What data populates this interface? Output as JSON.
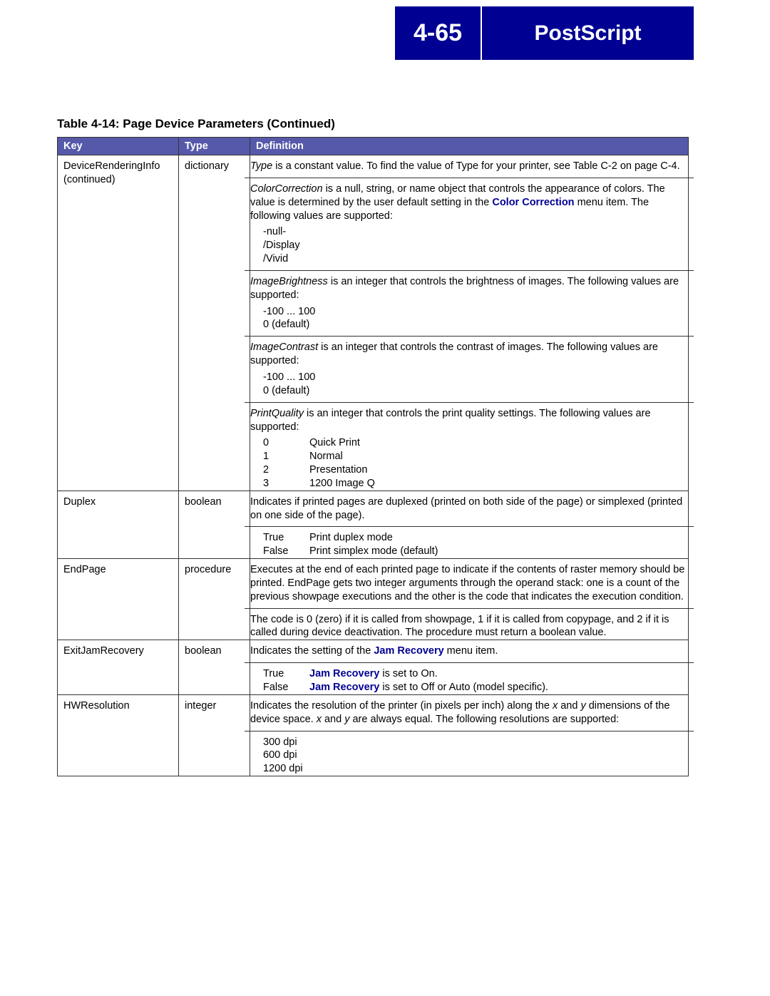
{
  "header": {
    "page_number": "4-65",
    "chapter_title": "PostScript"
  },
  "table": {
    "caption": "Table 4-14:  Page Device Parameters (Continued)",
    "headers": {
      "key": "Key",
      "type": "Type",
      "def": "Definition"
    },
    "rows": [
      {
        "key": "DeviceRenderingInfo (continued)",
        "type": "dictionary",
        "def": {
          "type_para_pre": "Type",
          "type_para": " is a constant value. To find the value of Type for your printer, see Table C-2 on page C-4.",
          "cc_pre": "ColorCorrection",
          "cc_mid": " is a null, string, or name object that controls the appearance of colors. The value is determined by the user default setting in the ",
          "cc_link": "Color Correction",
          "cc_post": " menu item. The following values are supported:",
          "cc_vals": [
            "-null-",
            "/Display",
            "/Vivid"
          ],
          "ib_pre": "ImageBrightness",
          "ib_text": " is an integer that controls the brightness of images. The following values are supported:",
          "ib_vals": [
            "-100 ... 100",
            "0 (default)"
          ],
          "ic_pre": "ImageContrast",
          "ic_text": " is an integer that controls the contrast of images. The following values are supported:",
          "ic_vals": [
            "-100 ... 100",
            "0 (default)"
          ],
          "pq_pre": "PrintQuality",
          "pq_text": " is an integer that controls the print quality settings. The following values are supported:",
          "pq_vals": [
            {
              "n": "0",
              "d": "Quick Print"
            },
            {
              "n": "1",
              "d": "Normal"
            },
            {
              "n": "2",
              "d": "Presentation"
            },
            {
              "n": "3",
              "d": "1200 Image Q"
            }
          ]
        }
      },
      {
        "key": "Duplex",
        "type": "boolean",
        "def": {
          "intro": "Indicates if printed pages are duplexed (printed on both side of the page) or simplexed (printed on one side of the page).",
          "vals": [
            {
              "n": "True",
              "d": "Print duplex mode"
            },
            {
              "n": "False",
              "d": "Print simplex mode (default)"
            }
          ]
        }
      },
      {
        "key": "EndPage",
        "type": "procedure",
        "def": {
          "p1": "Executes at the end of each printed page to indicate if the contents of raster memory should be printed. EndPage gets two integer arguments through the operand stack: one is a count of the previous showpage executions and the other is the code that indicates the execution condition.",
          "p2": "The code is 0 (zero) if it is called from showpage, 1 if it is called from copypage, and 2 if it is called during device deactivation. The procedure must return a boolean value."
        }
      },
      {
        "key": "ExitJamRecovery",
        "type": "boolean",
        "def": {
          "intro_pre": "Indicates the setting of the ",
          "intro_link": "Jam Recovery",
          "intro_post": " menu item.",
          "vals": [
            {
              "n": "True",
              "link": "Jam Recovery",
              "d": " is set to On."
            },
            {
              "n": "False",
              "link": "Jam Recovery",
              "d": " is set to Off or Auto (model specific)."
            }
          ]
        }
      },
      {
        "key": "HWResolution",
        "type": "integer",
        "def": {
          "intro_pre": "Indicates the resolution of the printer (in pixels per inch) along the ",
          "x": "x",
          "intro_mid1": " and ",
          "y": "y",
          "intro_mid2": " dimensions of the device space. ",
          "intro_mid3": " and ",
          "intro_post": " are always equal. The following resolutions are supported:",
          "vals": [
            "300 dpi",
            "600 dpi",
            "1200 dpi"
          ]
        }
      }
    ]
  }
}
